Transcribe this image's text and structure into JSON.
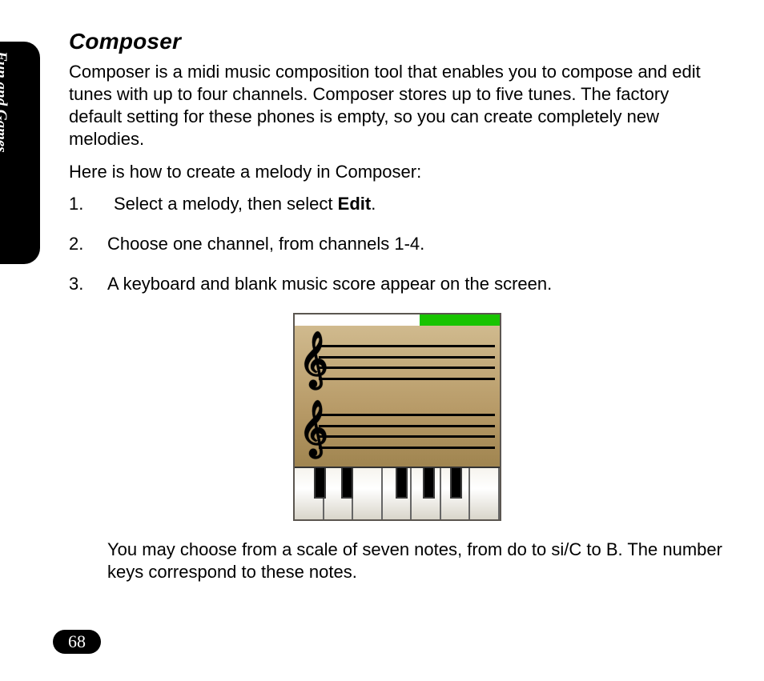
{
  "sidebar": {
    "section_label": "Fun and Games"
  },
  "page": {
    "title": "Composer",
    "intro": "Composer is a midi music composition tool that enables you to compose and edit tunes with up to four channels. Composer stores up to five tunes. The factory default setting for these phones is empty, so you can create completely new melodies.",
    "howto_lead": "Here is how to create a melody in Composer:",
    "steps": {
      "s1_pre": "Select a melody, then select ",
      "s1_bold": "Edit",
      "s1_post": ".",
      "s2": "Choose one channel, from channels 1-4.",
      "s3": "A keyboard and blank music score appear on the screen."
    },
    "after_figure": "You may choose from a scale of seven notes, from do to si/C to B. The number keys correspond to these notes.",
    "page_number": "68"
  },
  "figure": {
    "name": "composer-screen",
    "black_key_positions_percent": [
      9.5,
      22.7,
      49.2,
      62.4,
      75.6
    ]
  }
}
